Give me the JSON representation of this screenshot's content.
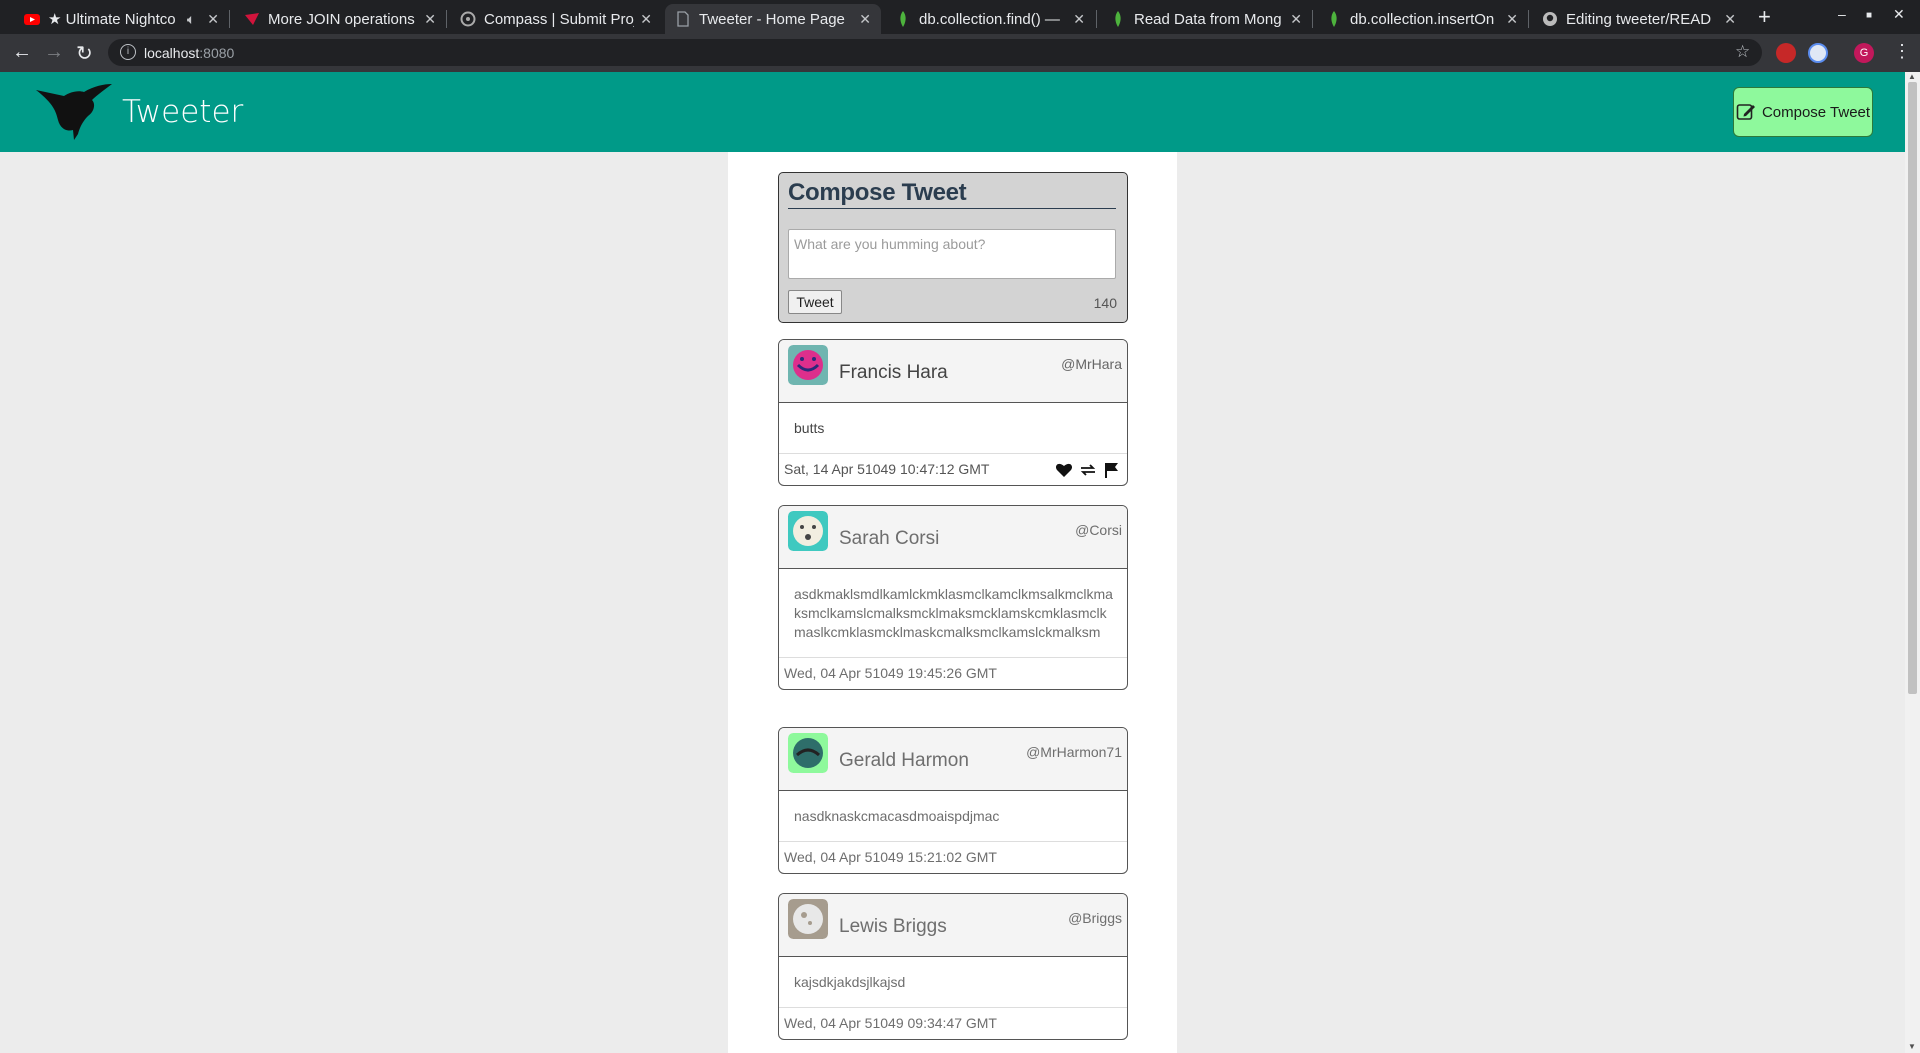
{
  "browser": {
    "tabs": [
      {
        "title": "★ Ultimate Nightco",
        "icon": "youtube-icon",
        "icon_color": "#ff0000"
      },
      {
        "title": "More JOIN operations",
        "icon": "sqlzoo-icon",
        "icon_color": "#d1143c"
      },
      {
        "title": "Compass | Submit Proj",
        "icon": "compass-icon",
        "icon_color": "#aaaaaa"
      },
      {
        "title": "Tweeter - Home Page",
        "icon": "page-icon",
        "icon_color": "#9aa0a6"
      },
      {
        "title": "db.collection.find() —",
        "icon": "mongodb-leaf-icon",
        "icon_color": "#4db33d"
      },
      {
        "title": "Read Data from Mong",
        "icon": "mongodb-leaf-icon",
        "icon_color": "#4db33d"
      },
      {
        "title": "db.collection.insertOn",
        "icon": "mongodb-leaf-icon",
        "icon_color": "#4db33d"
      },
      {
        "title": "Editing tweeter/READ",
        "icon": "github-icon",
        "icon_color": "#bbbbbb"
      }
    ],
    "active_tab_index": 3,
    "url_host": "localhost",
    "url_port": ":8080"
  },
  "app": {
    "brand": "Tweeter",
    "compose_button_label": "Compose Tweet",
    "header_color": "#009a88",
    "button_color": "#8ef99c"
  },
  "compose": {
    "title": "Compose Tweet",
    "placeholder": "What are you humming about?",
    "submit_label": "Tweet",
    "counter": "140"
  },
  "tweets": [
    {
      "name": "Francis Hara",
      "handle": "@MrHara",
      "text": "butts",
      "date": "Sat, 14 Apr 51049 10:47:12 GMT",
      "avatar_color": "#dd2f8c"
    },
    {
      "name": "Sarah Corsi",
      "handle": "@Corsi",
      "text": "asdkmaklsmdlkamlckmklasmclkamclkmsalkmclkmaksmclkamslcmalksmcklmaksmcklamskcmklasmclkmaslkcmklasmcklmaskcmalksmclkamslckmalksm",
      "date": "Wed, 04 Apr 51049 19:45:26 GMT",
      "avatar_color": "#f2eee0"
    },
    {
      "name": "Gerald Harmon",
      "handle": "@MrHarmon71",
      "text": "nasdknaskcmacasdmoaispdjmac",
      "date": "Wed, 04 Apr 51049 15:21:02 GMT",
      "avatar_color": "#2e6e6a"
    },
    {
      "name": "Lewis Briggs",
      "handle": "@Briggs",
      "text": "kajsdkjakdsjlkajsd",
      "date": "Wed, 04 Apr 51049 09:34:47 GMT",
      "avatar_color": "#e8e8e8"
    }
  ]
}
